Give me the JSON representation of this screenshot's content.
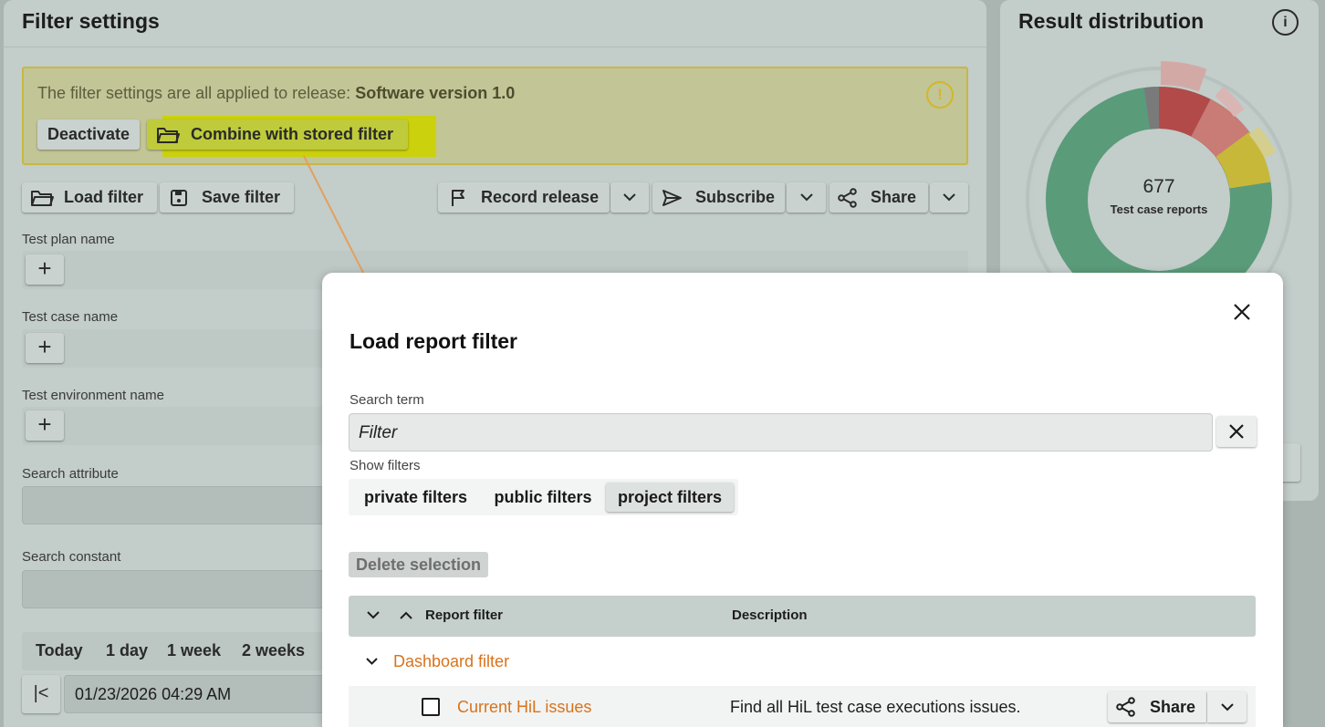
{
  "filter_settings": {
    "title": "Filter settings",
    "notice": {
      "text": "The filter settings are all applied to release: ",
      "release": "Software version 1.0",
      "deactivate_label": "Deactivate",
      "combine_label": "Combine with stored filter"
    },
    "toolbar": {
      "load_filter": "Load filter",
      "save_filter": "Save filter",
      "record_release": "Record release",
      "subscribe": "Subscribe",
      "share": "Share"
    },
    "fields": {
      "test_plan_name": "Test plan name",
      "test_case_name": "Test case name",
      "test_environment_name": "Test environment name",
      "search_attribute": "Search attribute",
      "search_constant": "Search constant"
    },
    "quick_ranges": [
      "Today",
      "1 day",
      "1 week",
      "2 weeks"
    ],
    "date_value": "01/23/2026 04:29 AM"
  },
  "result_distribution": {
    "title": "Result distribution",
    "total": "677",
    "total_label": "Test case reports",
    "colors": {
      "passed": "#5a9b7a",
      "failed": "#b24a4a",
      "failed_light": "#c97b76",
      "warning": "#c8b83a",
      "none": "#7a7a7a"
    }
  },
  "dialog": {
    "title": "Load report filter",
    "search_label": "Search term",
    "search_value": "Filter",
    "show_filters_label": "Show filters",
    "filter_types": [
      "private filters",
      "public filters",
      "project filters"
    ],
    "active_filter_type": "project filters",
    "delete_selection": "Delete selection",
    "columns": {
      "report_filter": "Report filter",
      "description": "Description"
    },
    "group": "Dashboard filter",
    "rows": [
      {
        "name": "Current HiL issues",
        "description": "Find all HiL test case executions issues.",
        "share": "Share"
      }
    ]
  },
  "accent_color": "#d8731c",
  "highlight_color": "#cbd10c"
}
